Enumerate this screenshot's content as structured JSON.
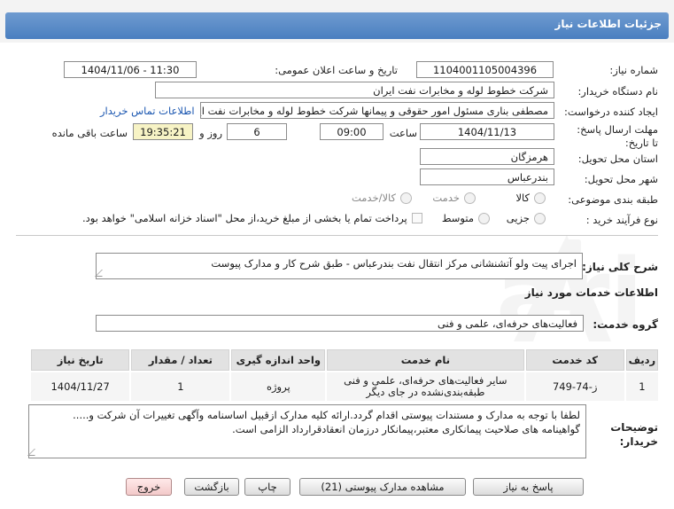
{
  "header": {
    "title": "جزئیات اطلاعات نیاز"
  },
  "watermark": {
    "text": "AriaTender.net"
  },
  "form": {
    "need_number_label": "شماره نیاز:",
    "need_number": "1104001105004396",
    "announce_label": "تاریخ و ساعت اعلان عمومی:",
    "announce_value": "1404/11/06 - 11:30",
    "buyer_org_label": "نام دستگاه خریدار:",
    "buyer_org": "شرکت خطوط لوله و مخابرات نفت ایران",
    "creator_label": "ایجاد کننده درخواست:",
    "creator": "مصطفی بناری مسئول امور حقوقی و پیمانها  شرکت خطوط لوله و مخابرات نفت ایران",
    "contact_link": "اطلاعات تماس خریدار",
    "deadline_label": "مهلت ارسال پاسخ: تا تاریخ:",
    "deadline_date": "1404/11/13",
    "time_label": "ساعت",
    "deadline_time": "09:00",
    "days_value": "6",
    "days_label": "روز و",
    "remaining_time": "19:35:21",
    "remaining_label": "ساعت باقی مانده",
    "province_label": "استان محل تحویل:",
    "province": "هرمزگان",
    "city_label": "شهر محل تحویل:",
    "city": "بندرعباس",
    "category_label": "طبقه بندی موضوعی:",
    "category_options": [
      "کالا",
      "خدمت",
      "کالا/خدمت"
    ],
    "purchase_type_label": "نوع فرآیند خرید :",
    "purchase_options": [
      "جزیی",
      "متوسط"
    ],
    "payment_note": "پرداخت تمام یا بخشی از مبلغ خرید،از محل \"اسناد خزانه اسلامی\" خواهد بود."
  },
  "description": {
    "label": "شرح کلی نیاز:",
    "text": "اجرای پیت ولو آتشنشانی مرکز انتقال نفت بندرعباس - طبق شرح کار و مدارک پیوست"
  },
  "services": {
    "section_title": "اطلاعات خدمات مورد نیاز",
    "group_label": "گروه خدمت:",
    "group_value": "فعالیت‌های حرفه‌ای، علمی و فنی",
    "columns": [
      "ردیف",
      "کد خدمت",
      "نام خدمت",
      "واحد اندازه گیری",
      "تعداد / مقدار",
      "تاریخ نیاز"
    ],
    "rows": [
      {
        "index": "1",
        "code": "ز-74-749",
        "name": "سایر فعالیت‌های حرفه‌ای، علمی و فنی طبقه‌بندی‌نشده در جای دیگر",
        "unit": "پروژه",
        "qty": "1",
        "date": "1404/11/27"
      }
    ]
  },
  "buyer_notes": {
    "label": "توضیحات خریدار:",
    "text": "لطفا با توجه به مدارک و مستندات پیوستی اقدام گردد.ارائه کلیه مدارک ازقبیل اساسنامه وآگهی تغییرات آن شرکت و..... گواهینامه های صلاحیت پیمانکاری معتبر،پیمانکار درزمان انعقادقرارداد الزامی است."
  },
  "buttons": {
    "reply": "پاسخ به نیاز",
    "attachments": "مشاهده مدارک پیوستی (21)",
    "print": "چاپ",
    "back": "بازگشت",
    "exit": "خروج"
  }
}
